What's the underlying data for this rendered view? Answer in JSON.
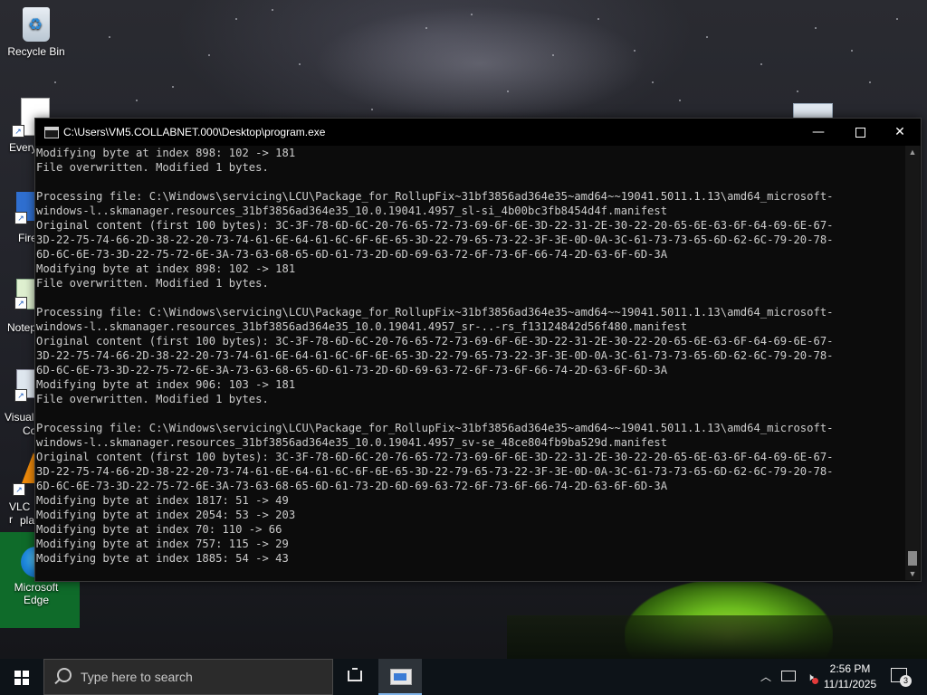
{
  "desktop": {
    "icons": {
      "recycle_bin": "Recycle Bin",
      "everything": "Every",
      "firefox": "Fire",
      "notepad": "Notep",
      "visual_studio": "Visual",
      "visual_studio_2": "Co",
      "vlc_1": "VLC r",
      "vlc_2": "pla",
      "edge_1": "Microsoft",
      "edge_2": "Edge"
    }
  },
  "console": {
    "title": "C:\\Users\\VM5.COLLABNET.000\\Desktop\\program.exe",
    "lines": [
      "Modifying byte at index 898: 102 -> 181",
      "File overwritten. Modified 1 bytes.",
      "",
      "Processing file: C:\\Windows\\servicing\\LCU\\Package_for_RollupFix~31bf3856ad364e35~amd64~~19041.5011.1.13\\amd64_microsoft-",
      "windows-l..skmanager.resources_31bf3856ad364e35_10.0.19041.4957_sl-si_4b00bc3fb8454d4f.manifest",
      "Original content (first 100 bytes): 3C-3F-78-6D-6C-20-76-65-72-73-69-6F-6E-3D-22-31-2E-30-22-20-65-6E-63-6F-64-69-6E-67-",
      "3D-22-75-74-66-2D-38-22-20-73-74-61-6E-64-61-6C-6F-6E-65-3D-22-79-65-73-22-3F-3E-0D-0A-3C-61-73-73-65-6D-62-6C-79-20-78-",
      "6D-6C-6E-73-3D-22-75-72-6E-3A-73-63-68-65-6D-61-73-2D-6D-69-63-72-6F-73-6F-66-74-2D-63-6F-6D-3A",
      "Modifying byte at index 898: 102 -> 181",
      "File overwritten. Modified 1 bytes.",
      "",
      "Processing file: C:\\Windows\\servicing\\LCU\\Package_for_RollupFix~31bf3856ad364e35~amd64~~19041.5011.1.13\\amd64_microsoft-",
      "windows-l..skmanager.resources_31bf3856ad364e35_10.0.19041.4957_sr-..-rs_f13124842d56f480.manifest",
      "Original content (first 100 bytes): 3C-3F-78-6D-6C-20-76-65-72-73-69-6F-6E-3D-22-31-2E-30-22-20-65-6E-63-6F-64-69-6E-67-",
      "3D-22-75-74-66-2D-38-22-20-73-74-61-6E-64-61-6C-6F-6E-65-3D-22-79-65-73-22-3F-3E-0D-0A-3C-61-73-73-65-6D-62-6C-79-20-78-",
      "6D-6C-6E-73-3D-22-75-72-6E-3A-73-63-68-65-6D-61-73-2D-6D-69-63-72-6F-73-6F-66-74-2D-63-6F-6D-3A",
      "Modifying byte at index 906: 103 -> 181",
      "File overwritten. Modified 1 bytes.",
      "",
      "Processing file: C:\\Windows\\servicing\\LCU\\Package_for_RollupFix~31bf3856ad364e35~amd64~~19041.5011.1.13\\amd64_microsoft-",
      "windows-l..skmanager.resources_31bf3856ad364e35_10.0.19041.4957_sv-se_48ce804fb9ba529d.manifest",
      "Original content (first 100 bytes): 3C-3F-78-6D-6C-20-76-65-72-73-69-6F-6E-3D-22-31-2E-30-22-20-65-6E-63-6F-64-69-6E-67-",
      "3D-22-75-74-66-2D-38-22-20-73-74-61-6E-64-61-6C-6F-6E-65-3D-22-79-65-73-22-3F-3E-0D-0A-3C-61-73-73-65-6D-62-6C-79-20-78-",
      "6D-6C-6E-73-3D-22-75-72-6E-3A-73-63-68-65-6D-61-73-2D-6D-69-63-72-6F-73-6F-66-74-2D-63-6F-6D-3A",
      "Modifying byte at index 1817: 51 -> 49",
      "Modifying byte at index 2054: 53 -> 203",
      "Modifying byte at index 70: 110 -> 66",
      "Modifying byte at index 757: 115 -> 29",
      "Modifying byte at index 1885: 54 -> 43"
    ],
    "icons": {
      "minimize": "minimize-icon",
      "maximize": "maximize-icon",
      "close": "close-icon"
    }
  },
  "taskbar": {
    "search_placeholder": "Type here to search",
    "time": "2:56 PM",
    "date": "11/11/2025",
    "notification_count": "3"
  },
  "colors": {
    "console_bg": "#0c0c0c",
    "console_text": "#cccccc",
    "taskbar_bg": "#0d1318",
    "tent_green": "#8fd42a"
  }
}
